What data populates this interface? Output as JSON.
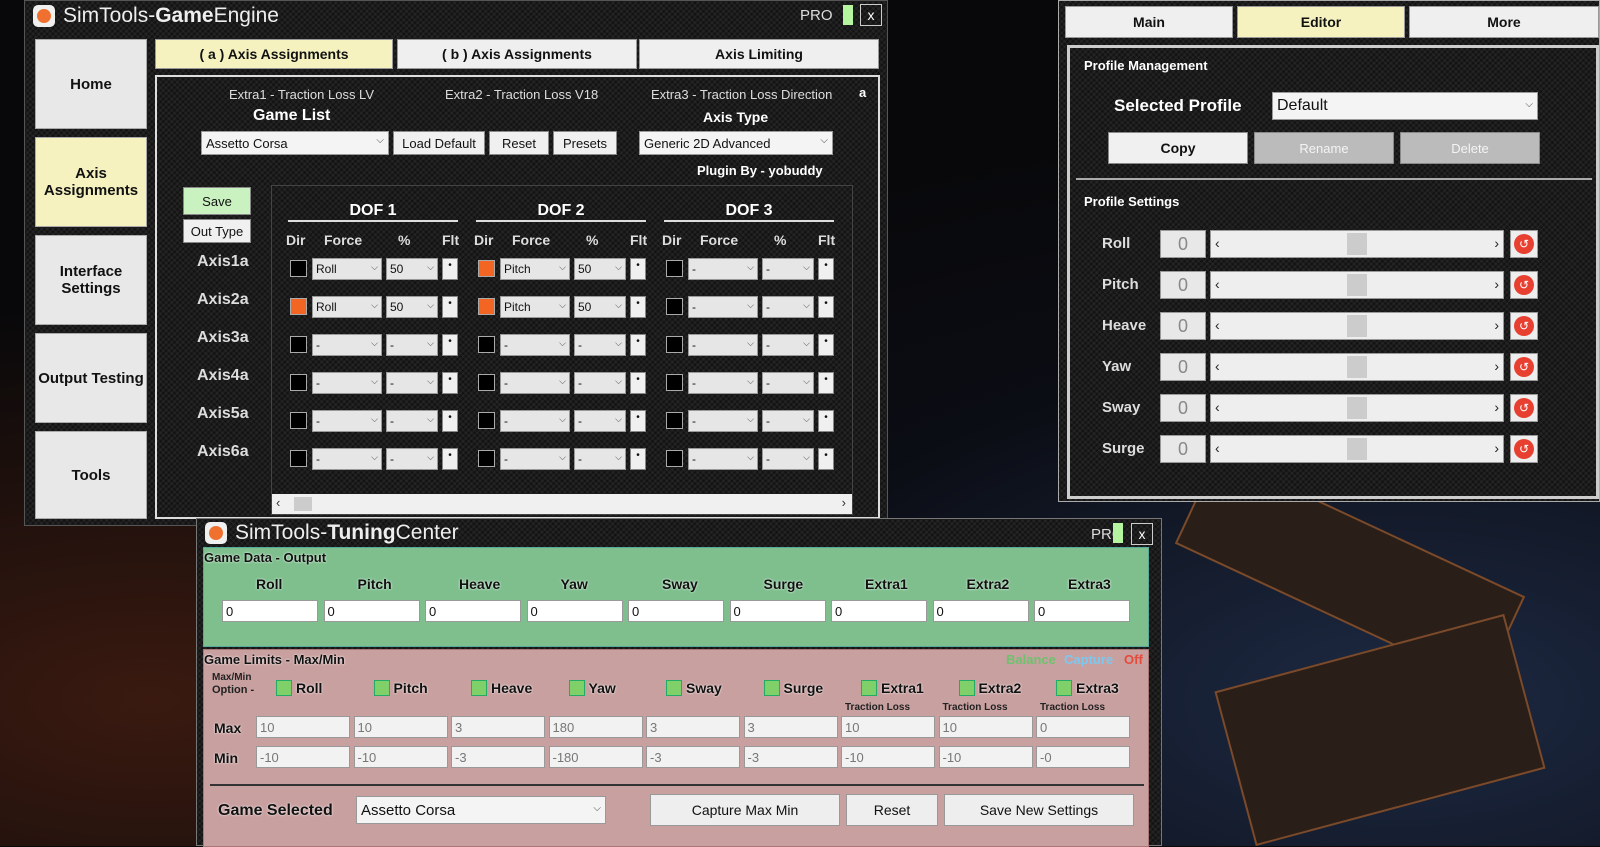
{
  "game_engine": {
    "title_a": "SimTools",
    "title_sep": " - ",
    "title_b": "Game",
    "title_c": " Engine",
    "pro": "PRO",
    "close": "x",
    "nav": [
      "Home",
      "Axis Assignments",
      "Interface Settings",
      "Output Testing",
      "Tools"
    ],
    "tabs": [
      "( a ) Axis Assignments",
      "( b ) Axis Assignments",
      "Axis Limiting"
    ],
    "extras": [
      "Extra1 - Traction Loss LV",
      "Extra2 - Traction Loss V18",
      "Extra3 - Traction Loss Direction"
    ],
    "corner_a": "a",
    "game_list_label": "Game List",
    "game_list_value": "Assetto Corsa",
    "load_default": "Load Default",
    "reset": "Reset",
    "presets": "Presets",
    "axis_type_label": "Axis Type",
    "axis_type_value": "Generic 2D Advanced",
    "plugin_by": "Plugin By - yobuddy",
    "save": "Save",
    "out_type": "Out Type",
    "dofs": [
      "DOF 1",
      "DOF 2",
      "DOF 3"
    ],
    "col_headers": [
      "Dir",
      "Force",
      "%",
      "Flt"
    ],
    "flt_mark": "•",
    "axes": [
      {
        "label": "Axis1a",
        "cells": [
          {
            "dir": false,
            "force": "Roll",
            "pct": "50"
          },
          {
            "dir": true,
            "force": "Pitch",
            "pct": "50"
          },
          {
            "dir": false,
            "force": "-",
            "pct": "-"
          }
        ]
      },
      {
        "label": "Axis2a",
        "cells": [
          {
            "dir": true,
            "force": "Roll",
            "pct": "50"
          },
          {
            "dir": true,
            "force": "Pitch",
            "pct": "50"
          },
          {
            "dir": false,
            "force": "-",
            "pct": "-"
          }
        ]
      },
      {
        "label": "Axis3a",
        "cells": [
          {
            "dir": false,
            "force": "-",
            "pct": "-"
          },
          {
            "dir": false,
            "force": "-",
            "pct": "-"
          },
          {
            "dir": false,
            "force": "-",
            "pct": "-"
          }
        ]
      },
      {
        "label": "Axis4a",
        "cells": [
          {
            "dir": false,
            "force": "-",
            "pct": "-"
          },
          {
            "dir": false,
            "force": "-",
            "pct": "-"
          },
          {
            "dir": false,
            "force": "-",
            "pct": "-"
          }
        ]
      },
      {
        "label": "Axis5a",
        "cells": [
          {
            "dir": false,
            "force": "-",
            "pct": "-"
          },
          {
            "dir": false,
            "force": "-",
            "pct": "-"
          },
          {
            "dir": false,
            "force": "-",
            "pct": "-"
          }
        ]
      },
      {
        "label": "Axis6a",
        "cells": [
          {
            "dir": false,
            "force": "-",
            "pct": "-"
          },
          {
            "dir": false,
            "force": "-",
            "pct": "-"
          },
          {
            "dir": false,
            "force": "-",
            "pct": "-"
          }
        ]
      }
    ]
  },
  "editor": {
    "tabs": [
      "Main",
      "Editor",
      "More"
    ],
    "profile_management": "Profile Management",
    "selected_profile_label": "Selected Profile",
    "selected_profile_value": "Default",
    "copy": "Copy",
    "rename": "Rename",
    "delete": "Delete",
    "profile_settings": "Profile Settings",
    "sliders": [
      {
        "label": "Roll",
        "value": "0"
      },
      {
        "label": "Pitch",
        "value": "0"
      },
      {
        "label": "Heave",
        "value": "0"
      },
      {
        "label": "Yaw",
        "value": "0"
      },
      {
        "label": "Sway",
        "value": "0"
      },
      {
        "label": "Surge",
        "value": "0"
      }
    ]
  },
  "tuning": {
    "title_a": "SimTools",
    "title_sep": " - ",
    "title_b": "Tuning",
    "title_c": " Center",
    "pro": "PRO",
    "close": "x",
    "game_data_label": "Game Data - Output",
    "outputs": [
      {
        "label": "Roll",
        "value": "0"
      },
      {
        "label": "Pitch",
        "value": "0"
      },
      {
        "label": "Heave",
        "value": "0"
      },
      {
        "label": "Yaw",
        "value": "0"
      },
      {
        "label": "Sway",
        "value": "0"
      },
      {
        "label": "Surge",
        "value": "0"
      },
      {
        "label": "Extra1",
        "value": "0"
      },
      {
        "label": "Extra2",
        "value": "0"
      },
      {
        "label": "Extra3",
        "value": "0"
      }
    ],
    "game_limits_label": "Game Limits - Max/Min",
    "balance": "Balance",
    "capture": "Capture",
    "off": "Off",
    "maxmin_option_1": "Max/Min",
    "maxmin_option_2": "Option -",
    "max_label": "Max",
    "min_label": "Min",
    "limits": [
      {
        "label": "Roll",
        "sub": "",
        "max": "10",
        "min": "-10"
      },
      {
        "label": "Pitch",
        "sub": "",
        "max": "10",
        "min": "-10"
      },
      {
        "label": "Heave",
        "sub": "",
        "max": "3",
        "min": "-3"
      },
      {
        "label": "Yaw",
        "sub": "",
        "max": "180",
        "min": "-180"
      },
      {
        "label": "Sway",
        "sub": "",
        "max": "3",
        "min": "-3"
      },
      {
        "label": "Surge",
        "sub": "",
        "max": "3",
        "min": "-3"
      },
      {
        "label": "Extra1",
        "sub": "Traction Loss",
        "max": "10",
        "min": "-10"
      },
      {
        "label": "Extra2",
        "sub": "Traction Loss",
        "max": "10",
        "min": "-10"
      },
      {
        "label": "Extra3",
        "sub": "Traction Loss",
        "max": "0",
        "min": "-0"
      }
    ],
    "game_selected_label": "Game Selected",
    "game_selected_value": "Assetto Corsa",
    "capture_max_min": "Capture Max Min",
    "reset": "Reset",
    "save_new_settings": "Save New Settings"
  },
  "colors": {
    "accent_orange": "#f26522",
    "active_tab": "#f5f2c0",
    "game_data_bg": "#7fbf8e",
    "game_limits_bg": "#c9a0a0"
  }
}
